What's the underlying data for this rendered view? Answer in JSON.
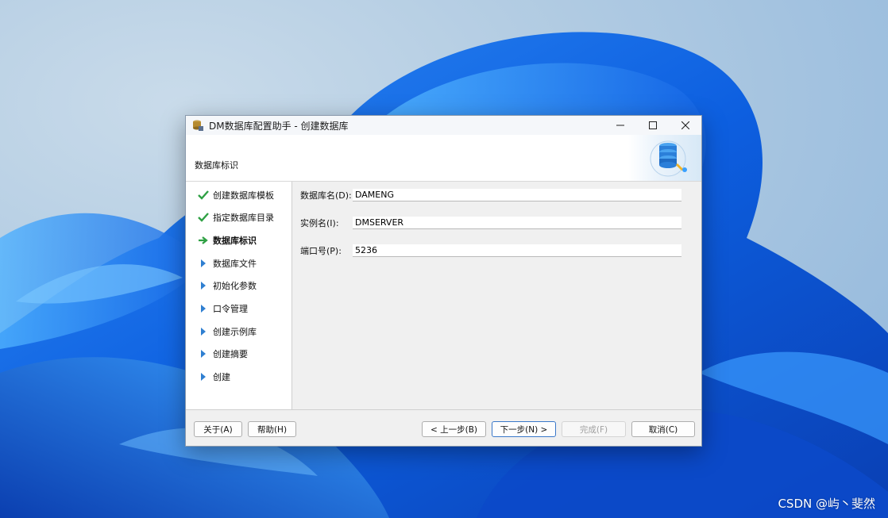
{
  "window": {
    "title": "DM数据库配置助手 - 创建数据库",
    "header_title": "数据库标识"
  },
  "steps": [
    {
      "label": "创建数据库模板",
      "status": "done",
      "icon": "check-icon"
    },
    {
      "label": "指定数据库目录",
      "status": "done",
      "icon": "check-icon"
    },
    {
      "label": "数据库标识",
      "status": "current",
      "icon": "arrow-right-icon"
    },
    {
      "label": "数据库文件",
      "status": "pending",
      "icon": "triangle-right-icon"
    },
    {
      "label": "初始化参数",
      "status": "pending",
      "icon": "triangle-right-icon"
    },
    {
      "label": "口令管理",
      "status": "pending",
      "icon": "triangle-right-icon"
    },
    {
      "label": "创建示例库",
      "status": "pending",
      "icon": "triangle-right-icon"
    },
    {
      "label": "创建摘要",
      "status": "pending",
      "icon": "triangle-right-icon"
    },
    {
      "label": "创建",
      "status": "pending",
      "icon": "triangle-right-icon"
    }
  ],
  "form": {
    "db_name_label": "数据库名(D):",
    "db_name_value": "DAMENG",
    "instance_label": "实例名(I):",
    "instance_value": "DMSERVER",
    "port_label": "端口号(P):",
    "port_value": "5236"
  },
  "buttons": {
    "about": "关于(A)",
    "help": "帮助(H)",
    "back": "< 上一步(B)",
    "next": "下一步(N) >",
    "finish": "完成(F)",
    "cancel": "取消(C)"
  },
  "watermark": "CSDN @屿丶斐然",
  "colors": {
    "check": "#2ea043",
    "arrow": "#2ea043",
    "pending_triangle": "#2f7fd1",
    "primary_border": "#3a78c9"
  }
}
